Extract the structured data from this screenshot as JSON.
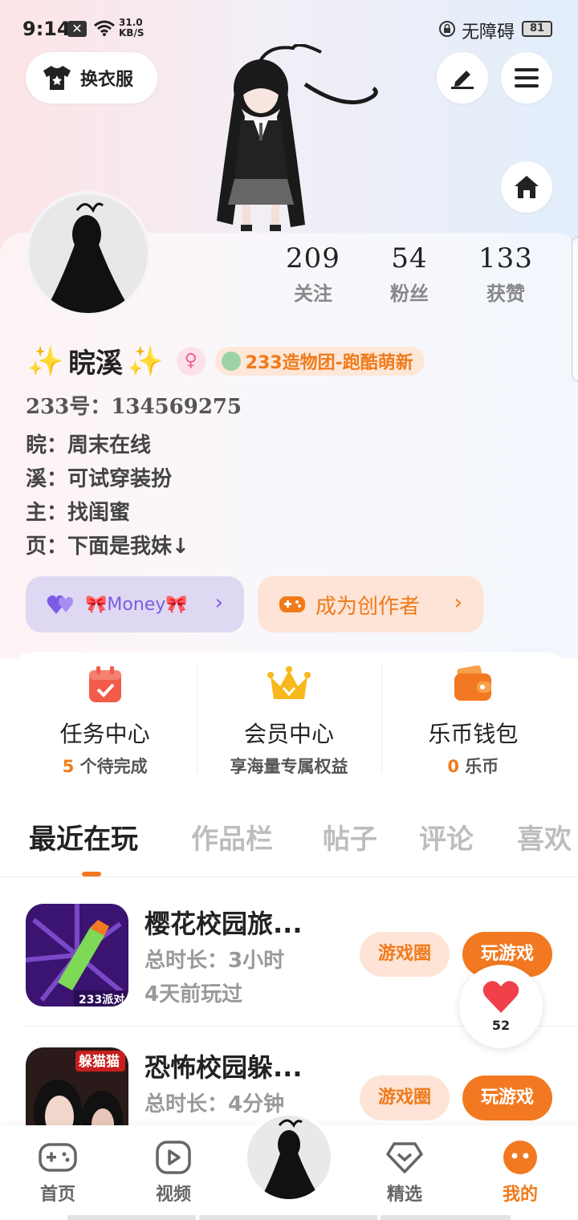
{
  "status_bar": {
    "time": "9:14",
    "speed_value": "31.0",
    "speed_unit": "KB/S",
    "accessibility": "无障碍",
    "battery": "81"
  },
  "header": {
    "outfit_label": "换衣服"
  },
  "profile": {
    "stats": [
      {
        "value": "209",
        "label": "关注"
      },
      {
        "value": "54",
        "label": "粉丝"
      },
      {
        "value": "133",
        "label": "获赞"
      }
    ],
    "name": "睆溪",
    "sparkle": "✨",
    "gender_symbol": "♀",
    "team_label": "233造物团-跑酷萌新",
    "uid": "233号：134569275",
    "bio": [
      "睆：周末在线",
      "溪：可试穿装扮",
      "主：找闺蜜",
      "页：下面是我妹↓"
    ],
    "money_label": "🎀Money🎀",
    "creator_label": "成为创作者"
  },
  "center": {
    "items": [
      {
        "title": "任务中心",
        "sub_highlight": "5",
        "sub_rest": "个待完成"
      },
      {
        "title": "会员中心",
        "sub_highlight": "",
        "sub_rest": "享海量专属权益"
      },
      {
        "title": "乐币钱包",
        "sub_highlight": "0",
        "sub_rest": "乐币"
      }
    ]
  },
  "tabs": [
    "最近在玩",
    "作品栏",
    "帖子",
    "评论",
    "喜欢"
  ],
  "games": [
    {
      "title": "樱花校园旅...",
      "duration": "总时长：3小时",
      "last_played": "4天前玩过",
      "circle_label": "游戏圈",
      "play_label": "玩游戏",
      "icon_badge": "233派对"
    },
    {
      "title": "恐怖校园躲...",
      "duration": "总时长：4分钟",
      "last_played": "",
      "circle_label": "游戏圈",
      "play_label": "玩游戏",
      "icon_badge": "躲猫猫"
    }
  ],
  "like_count": "52",
  "nav": {
    "home": "首页",
    "video": "视频",
    "featured": "精选",
    "mine": "我的"
  },
  "colors": {
    "accent": "#f27921",
    "money": "#7b5ce4"
  }
}
